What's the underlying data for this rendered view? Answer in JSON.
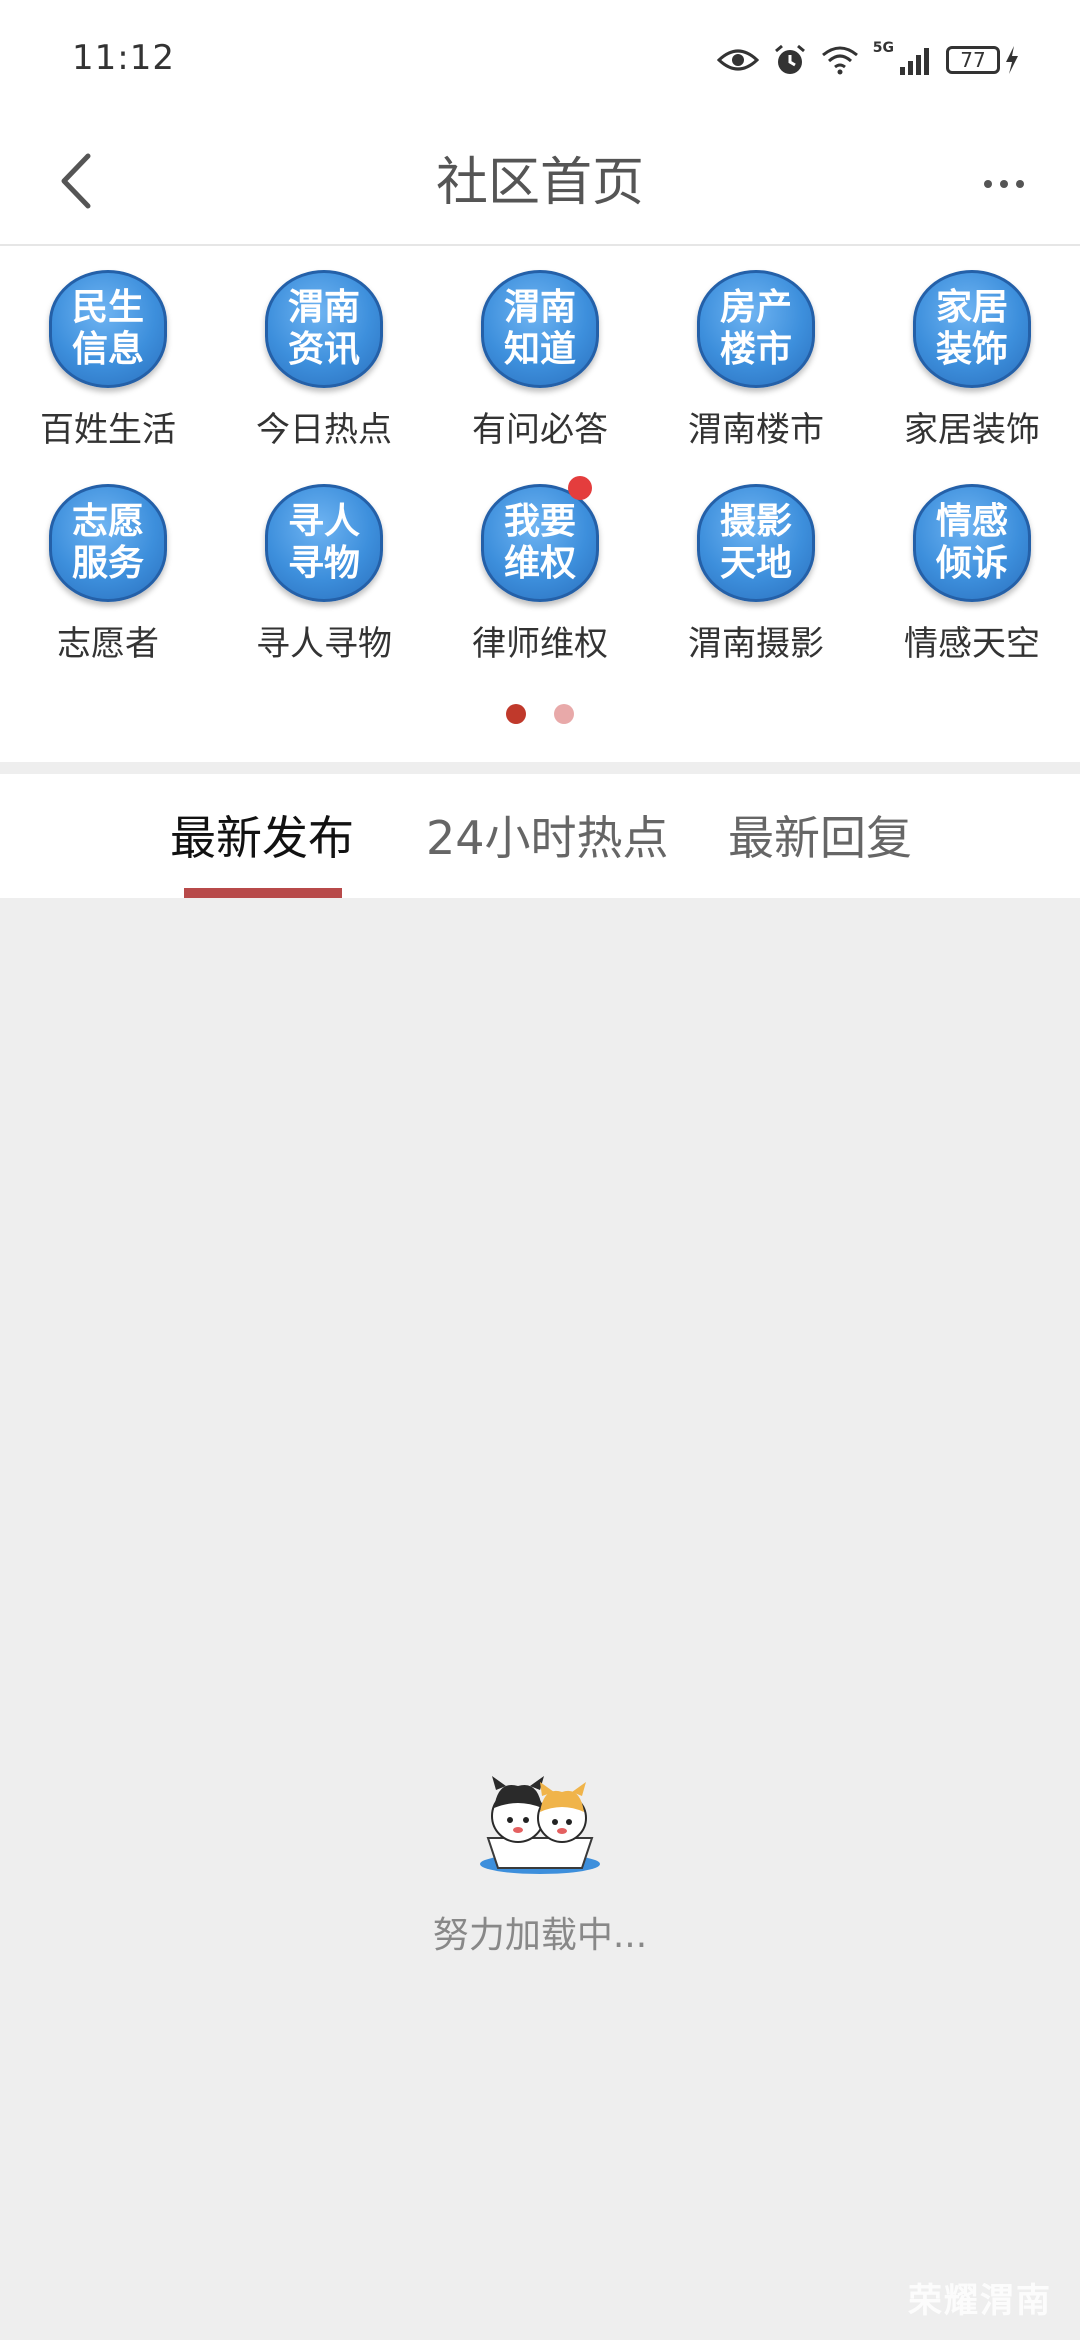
{
  "status_bar": {
    "time": "11:12",
    "network": "5G",
    "battery": "77",
    "icons": [
      "eye-icon",
      "alarm-icon",
      "wifi-icon",
      "signal-icon",
      "battery-icon",
      "charging-icon"
    ]
  },
  "nav": {
    "title": "社区首页",
    "back_icon": "chevron-left-icon",
    "more_icon": "more-dots-icon"
  },
  "grid": {
    "items": [
      {
        "tile": "民生\n信息",
        "label": "百姓生活",
        "badge": false
      },
      {
        "tile": "渭南\n资讯",
        "label": "今日热点",
        "badge": false
      },
      {
        "tile": "渭南\n知道",
        "label": "有问必答",
        "badge": false
      },
      {
        "tile": "房产\n楼市",
        "label": "渭南楼市",
        "badge": false
      },
      {
        "tile": "家居\n装饰",
        "label": "家居装饰",
        "badge": false
      },
      {
        "tile": "志愿\n服务",
        "label": "志愿者",
        "badge": false
      },
      {
        "tile": "寻人\n寻物",
        "label": "寻人寻物",
        "badge": false
      },
      {
        "tile": "我要\n维权",
        "label": "律师维权",
        "badge": true
      },
      {
        "tile": "摄影\n天地",
        "label": "渭南摄影",
        "badge": false
      },
      {
        "tile": "情感\n倾诉",
        "label": "情感天空",
        "badge": false
      }
    ],
    "pager": {
      "count": 2,
      "active": 0,
      "active_color": "#c0392b",
      "inactive_color": "#e8a9a9"
    }
  },
  "tabs": [
    {
      "label": "最新发布",
      "active": true
    },
    {
      "label": "24小时热点",
      "active": false
    },
    {
      "label": "最新回复",
      "active": false
    }
  ],
  "loading": {
    "text": "努力加载中..."
  },
  "watermark": "荣耀渭南",
  "colors": {
    "accent": "#b84a4a",
    "tile_blue": "#3d8fdc",
    "badge_red": "#e43d3d"
  }
}
